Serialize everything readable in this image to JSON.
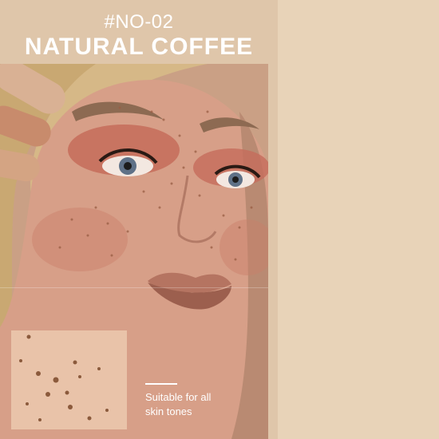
{
  "header": {
    "shade_code": "#NO-02",
    "shade_name": "NATURAL COFFEE"
  },
  "caption": {
    "line1": "Suitable for all",
    "line2": "skin tones"
  },
  "colors": {
    "background": "#e8d3b8",
    "panel": "#dfc6aa",
    "text": "#ffffff",
    "freckle": "#8b5a3c"
  }
}
